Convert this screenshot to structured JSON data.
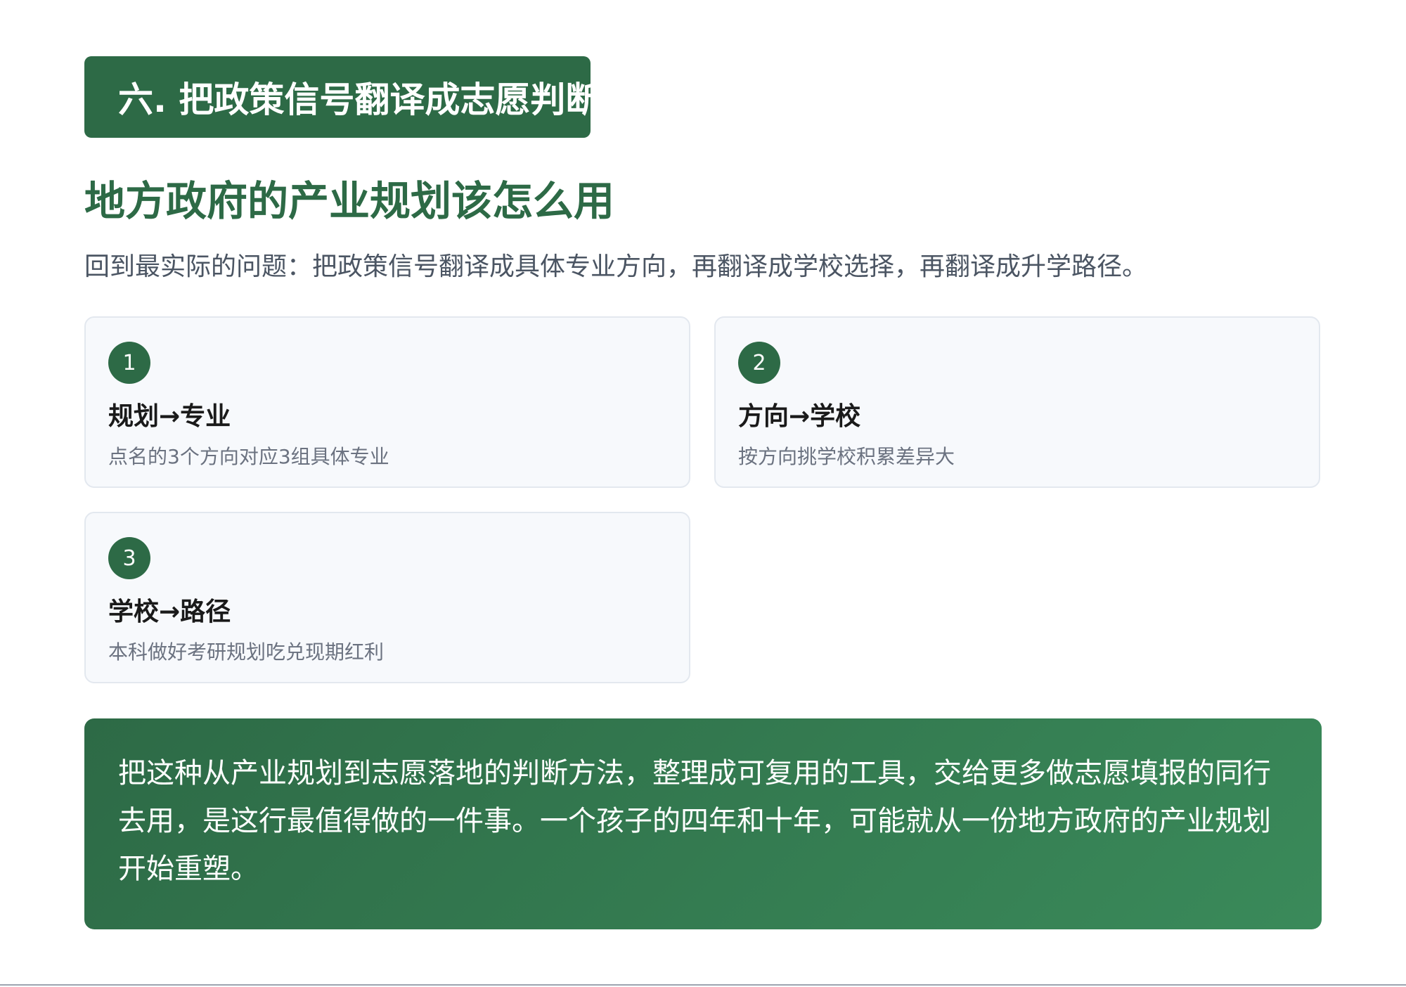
{
  "section": {
    "badge": "六. 把政策信号翻译成志愿判断"
  },
  "main": {
    "title": "地方政府的产业规划该怎么用",
    "subtitle": "回到最实际的问题：把政策信号翻译成具体专业方向，再翻译成学校选择，再翻译成升学路径。"
  },
  "cards": [
    {
      "number": "1",
      "title": "规划→专业",
      "desc": "点名的3个方向对应3组具体专业"
    },
    {
      "number": "2",
      "title": "方向→学校",
      "desc": "按方向挑学校积累差异大"
    },
    {
      "number": "3",
      "title": "学校→路径",
      "desc": "本科做好考研规划吃兑现期红利"
    }
  ],
  "conclusion": {
    "text": "把这种从产业规划到志愿落地的判断方法，整理成可复用的工具，交给更多做志愿填报的同行去用，是这行最值得做的一件事。一个孩子的四年和十年，可能就从一份地方政府的产业规划开始重塑。"
  },
  "colors": {
    "accent": "#2d6a46",
    "card_bg": "#f7f9fc",
    "card_border": "#e3e8ef"
  }
}
